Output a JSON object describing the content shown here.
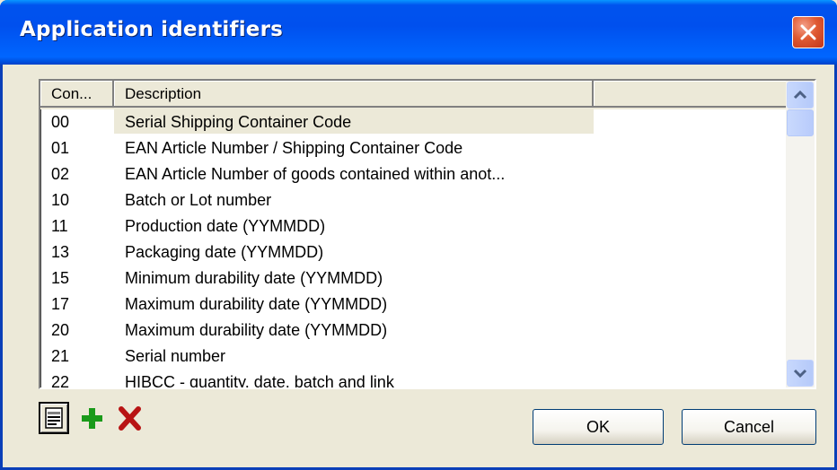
{
  "window": {
    "title": "Application identifiers"
  },
  "list": {
    "columns": [
      "Con...",
      "Description"
    ],
    "rows": [
      {
        "code": "00",
        "description": "Serial Shipping Container Code",
        "selected": true
      },
      {
        "code": "01",
        "description": "EAN Article Number / Shipping Container Code"
      },
      {
        "code": "02",
        "description": "EAN Article Number of goods contained within anot..."
      },
      {
        "code": "10",
        "description": "Batch or Lot number"
      },
      {
        "code": "11",
        "description": "Production date (YYMMDD)"
      },
      {
        "code": "13",
        "description": "Packaging date (YYMMDD)"
      },
      {
        "code": "15",
        "description": "Minimum durability date (YYMMDD)"
      },
      {
        "code": "17",
        "description": "Maximum durability date (YYMMDD)"
      },
      {
        "code": "20",
        "description": "Maximum durability date (YYMMDD)"
      },
      {
        "code": "21",
        "description": "Serial number"
      },
      {
        "code": "22",
        "description": "HIBCC - quantity, date, batch and link"
      }
    ]
  },
  "toolbar": {
    "icons": [
      "properties-icon",
      "add-icon",
      "delete-icon"
    ]
  },
  "buttons": {
    "ok": "OK",
    "cancel": "Cancel"
  }
}
